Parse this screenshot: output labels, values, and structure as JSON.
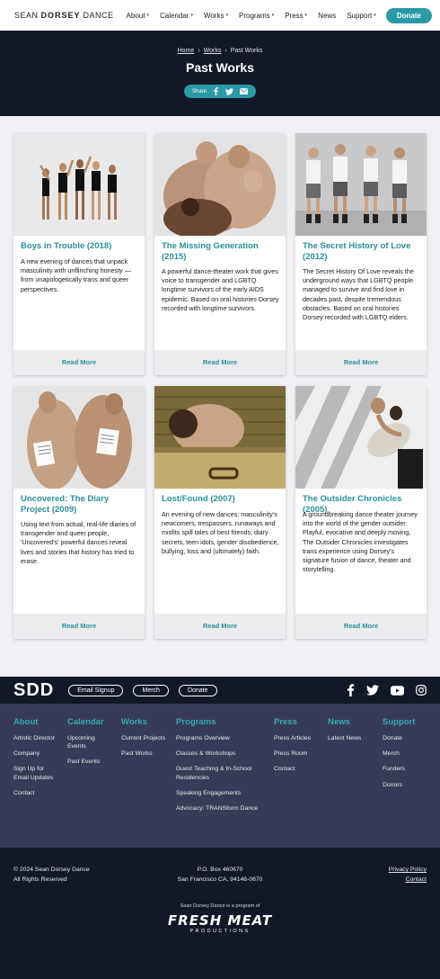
{
  "nav": {
    "logo_light1": "SEAN ",
    "logo_bold": "DORSEY",
    "logo_light2": " DANCE",
    "items": [
      {
        "label": "About",
        "caret": true
      },
      {
        "label": "Calendar",
        "caret": true
      },
      {
        "label": "Works",
        "caret": true
      },
      {
        "label": "Programs",
        "caret": true
      },
      {
        "label": "Press",
        "caret": true
      },
      {
        "label": "News",
        "caret": false
      },
      {
        "label": "Support",
        "caret": true
      }
    ],
    "donate": "Donate"
  },
  "hero": {
    "crumb_home": "Home",
    "crumb_works": "Works",
    "crumb_current": "Past Works",
    "sep": "›",
    "title": "Past Works",
    "share_label": "Share",
    "share_icons": [
      "facebook-icon",
      "twitter-icon",
      "email-icon"
    ]
  },
  "works": [
    {
      "title": "Boys in Trouble (2018)",
      "desc": "A new evening of dances that unpack masculinity with unflinching honesty — from unapologetically trans and queer perspectives.",
      "more": "Read More"
    },
    {
      "title": "The Missing Generation (2015)",
      "desc": "A powerful dance-theater work that gives voice to transgender and LGBTQ longtime survivors of the early AIDS epidemic. Based on oral histories Dorsey recorded with longtime survivors.",
      "more": "Read More"
    },
    {
      "title": "The Secret History of Love (2012)",
      "desc": "The Secret History Of Love reveals the underground ways that LGBTQ people managed to survive and find love in decades past, despite tremendous obstacles. Based on oral histories Dorsey recorded with LGBTQ elders.",
      "more": "Read More"
    },
    {
      "title": "Uncovered: The Diary Project (2009)",
      "desc": "Using text from actual, real-life diaries of transgender and queer people, 'Uncovered's' powerful dances reveal lives and stories that history has tried to erase.",
      "more": "Read More"
    },
    {
      "title": "Lost/Found (2007)",
      "desc": "An evening of new dances: masculinity's newcomers, trespassers, runaways and misfits spill tales of best friends, diary secrets, teen idols, gender disobedience, bullying, loss and (ultimately) faith.",
      "more": "Read More"
    },
    {
      "title": "The Outsider Chronicles (2005)",
      "desc": "A groundbreaking dance theater journey into the world of the gender outsider. Playful, evocative and deeply moving, The Outsider Chronicles investigates trans experience using Dorsey's signature fusion of dance, theater and storytelling.",
      "more": "Read More"
    }
  ],
  "footer": {
    "logo": "SDD",
    "pills": [
      "Email Signup",
      "Merch",
      "Donate"
    ],
    "social_icons": [
      "facebook-icon",
      "twitter-icon",
      "youtube-icon",
      "instagram-icon"
    ],
    "columns": [
      {
        "head": "About",
        "links": [
          "Artistic Director",
          "Company",
          "Sign Up for Email Updates",
          "Contact"
        ]
      },
      {
        "head": "Calendar",
        "links": [
          "Upcoming Events",
          "Past Events"
        ]
      },
      {
        "head": "Works",
        "links": [
          "Current Projects",
          "Past Works"
        ]
      },
      {
        "head": "Programs",
        "links": [
          "Programs Overview",
          "Classes & Workshops",
          "Guest Teaching & In-School Residencies",
          "Speaking Engagements",
          "Advocacy: TRANSform Dance"
        ]
      },
      {
        "head": "Press",
        "links": [
          "Press Articles",
          "Press Room",
          "Contact"
        ]
      },
      {
        "head": "News",
        "links": [
          "Latest News"
        ]
      },
      {
        "head": "Support",
        "links": [
          "Donate",
          "Merch",
          "Funders",
          "Donors"
        ]
      }
    ],
    "copyright": "© 2024 Sean Dorsey Dance",
    "rights": "All Rights Reserved",
    "address1": "P.O. Box 460670",
    "address2": "San Francisco CA, 94146-0670",
    "privacy": "Privacy Policy",
    "contact": "Contact",
    "program_note": "Sean Dorsey Dance is a program of",
    "fm_big": "FRESH MEAT",
    "fm_small": "PRODUCTIONS"
  },
  "colors": {
    "accent": "#2a9aa4",
    "dark": "#121827",
    "footer_mid": "#363c58"
  }
}
